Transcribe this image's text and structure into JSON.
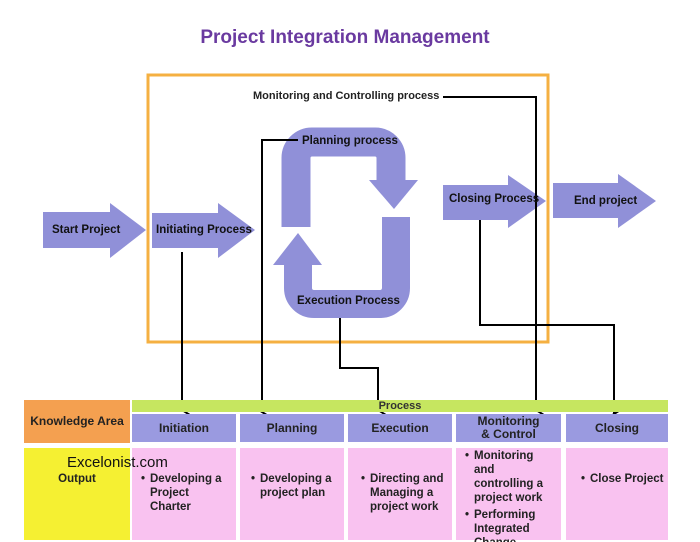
{
  "title": "Project Integration Management",
  "colors": {
    "title": "#6a3aa0",
    "arrow": "#9090d8",
    "boundary": "#f5b041",
    "knowledge": "#f4a050",
    "process_bar": "#c6e660",
    "header": "#9a9ae0",
    "output_label": "#f5f032",
    "output_cell": "#f9c2f0"
  },
  "flow": {
    "start": "Start Project",
    "initiating": "Initiating Process",
    "planning": "Planning process",
    "execution": "Execution Process",
    "monitoring": "Monitoring and Controlling process",
    "closing": "Closing Process",
    "end": "End project"
  },
  "table": {
    "knowledge_area": "Knowledge Area",
    "process": "Process",
    "output": "Output",
    "watermark": "Excelonist.com",
    "columns": [
      {
        "header": "Initiation",
        "outputs": [
          "Developing a Project Charter"
        ]
      },
      {
        "header": "Planning",
        "outputs": [
          "Developing a project plan"
        ]
      },
      {
        "header": "Execution",
        "outputs": [
          "Directing and Managing a project work"
        ]
      },
      {
        "header": "Monitoring & Control",
        "outputs": [
          "Monitoring and controlling a project work",
          "Performing Integrated Change control"
        ]
      },
      {
        "header": "Closing",
        "outputs": [
          "Close Project"
        ]
      }
    ]
  }
}
